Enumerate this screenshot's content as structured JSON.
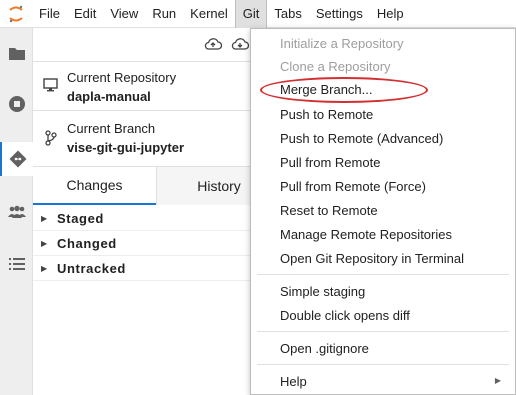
{
  "menubar": {
    "items": [
      "File",
      "Edit",
      "View",
      "Run",
      "Kernel",
      "Git",
      "Tabs",
      "Settings",
      "Help"
    ]
  },
  "git_panel": {
    "repository_label": "Current Repository",
    "repository_value": "dapla-manual",
    "branch_label": "Current Branch",
    "branch_value": "vise-git-gui-jupyter",
    "tabs": [
      "Changes",
      "History"
    ],
    "sections": [
      "Staged",
      "Changed",
      "Untracked"
    ]
  },
  "git_menu": {
    "items": [
      {
        "label": "Initialize a Repository",
        "enabled": false
      },
      {
        "label": "Clone a Repository",
        "enabled": false
      },
      {
        "label": "Merge Branch...",
        "enabled": true,
        "highlighted": true
      },
      {
        "label": "Push to Remote",
        "enabled": true
      },
      {
        "label": "Push to Remote (Advanced)",
        "enabled": true
      },
      {
        "label": "Pull from Remote",
        "enabled": true
      },
      {
        "label": "Pull from Remote (Force)",
        "enabled": true
      },
      {
        "label": "Reset to Remote",
        "enabled": true
      },
      {
        "label": "Manage Remote Repositories",
        "enabled": true
      },
      {
        "label": "Open Git Repository in Terminal",
        "enabled": true
      },
      {
        "label": "Simple staging",
        "enabled": true
      },
      {
        "label": "Double click opens diff",
        "enabled": true
      },
      {
        "label": "Open .gitignore",
        "enabled": true
      },
      {
        "label": "Help",
        "enabled": true,
        "submenu": true
      }
    ]
  },
  "colors": {
    "accent": "#1976d2",
    "highlight_ellipse": "#d32f2f",
    "logo": "#f37726"
  }
}
